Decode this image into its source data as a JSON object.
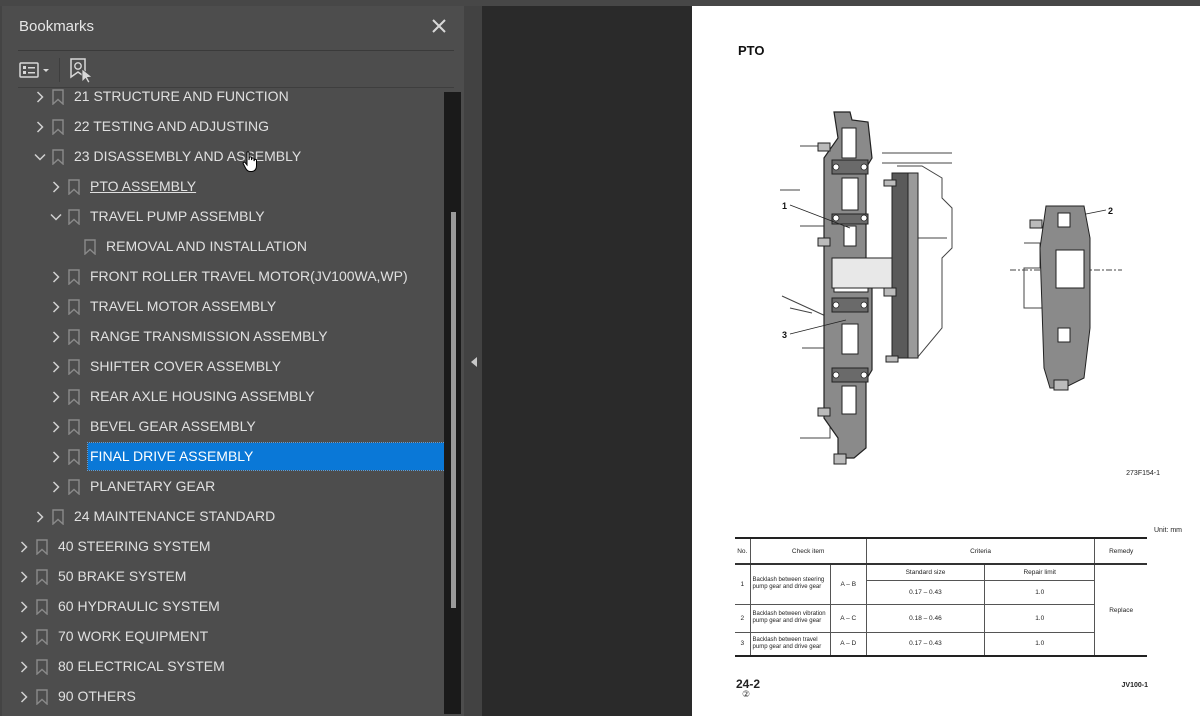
{
  "sidebar": {
    "title": "Bookmarks",
    "close_icon": "close-icon",
    "toolbar": {
      "options_icon": "list-options-icon",
      "find_bookmark_icon": "find-current-bookmark-icon"
    },
    "items": [
      {
        "label": "21 STRUCTURE AND FUNCTION",
        "level": 1,
        "expander": "collapsed"
      },
      {
        "label": "22 TESTING AND ADJUSTING",
        "level": 1,
        "expander": "collapsed"
      },
      {
        "label": "23 DISASSEMBLY AND ASSEMBLY",
        "level": 1,
        "expander": "expanded"
      },
      {
        "label": "PTO ASSEMBLY",
        "level": 2,
        "expander": "collapsed",
        "hover_link": true
      },
      {
        "label": "TRAVEL PUMP ASSEMBLY",
        "level": 2,
        "expander": "expanded"
      },
      {
        "label": "REMOVAL AND INSTALLATION",
        "level": 3,
        "expander": "none"
      },
      {
        "label": "FRONT ROLLER TRAVEL MOTOR(JV100WA,WP)",
        "level": 2,
        "expander": "collapsed"
      },
      {
        "label": "TRAVEL MOTOR ASSEMBLY",
        "level": 2,
        "expander": "collapsed"
      },
      {
        "label": "RANGE TRANSMISSION ASSEMBLY",
        "level": 2,
        "expander": "collapsed"
      },
      {
        "label": "SHIFTER COVER ASSEMBLY",
        "level": 2,
        "expander": "collapsed"
      },
      {
        "label": "REAR AXLE HOUSING ASSEMBLY",
        "level": 2,
        "expander": "collapsed"
      },
      {
        "label": "BEVEL GEAR ASSEMBLY",
        "level": 2,
        "expander": "collapsed"
      },
      {
        "label": "FINAL DRIVE ASSEMBLY",
        "level": 2,
        "expander": "collapsed",
        "selected": true
      },
      {
        "label": "PLANETARY GEAR",
        "level": 2,
        "expander": "collapsed"
      },
      {
        "label": "24 MAINTENANCE STANDARD",
        "level": 1,
        "expander": "collapsed"
      },
      {
        "label": "40 STEERING SYSTEM",
        "level": 0,
        "expander": "collapsed"
      },
      {
        "label": "50 BRAKE SYSTEM",
        "level": 0,
        "expander": "collapsed"
      },
      {
        "label": "60 HYDRAULIC SYSTEM",
        "level": 0,
        "expander": "collapsed"
      },
      {
        "label": "70 WORK EQUIPMENT",
        "level": 0,
        "expander": "collapsed"
      },
      {
        "label": "80 ELECTRICAL SYSTEM",
        "level": 0,
        "expander": "collapsed"
      },
      {
        "label": "90 OTHERS",
        "level": 0,
        "expander": "collapsed"
      }
    ],
    "selection_color": "#0a78d7"
  },
  "document": {
    "page_title": "PTO",
    "figure": {
      "callouts": [
        "1",
        "2",
        "3"
      ],
      "figure_id": "273F154-1"
    },
    "unit_label": "Unit:  mm",
    "table": {
      "headers": {
        "no": "No.",
        "check_item": "Check item",
        "criteria": "Criteria",
        "remedy": "Remedy"
      },
      "subheaders": {
        "standard": "Standard size",
        "repair": "Repair limit"
      },
      "rows": [
        {
          "no": "1",
          "item": "Backlash between steering pump gear and drive gear",
          "gears": "A – B",
          "standard": "0.17 – 0.43",
          "repair": "1.0"
        },
        {
          "no": "2",
          "item": "Backlash between vibration pump gear and drive gear",
          "gears": "A – C",
          "standard": "0.18 – 0.46",
          "repair": "1.0"
        },
        {
          "no": "3",
          "item": "Backlash between travel pump gear and drive gear",
          "gears": "A – D",
          "standard": "0.17 – 0.43",
          "repair": "1.0"
        }
      ],
      "remedy": "Replace"
    },
    "page_number": "24-2",
    "revision_mark": "②",
    "model": "JV100-1"
  }
}
